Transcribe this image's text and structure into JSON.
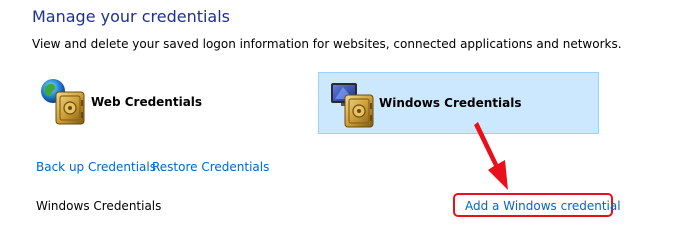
{
  "header": {
    "title": "Manage your credentials",
    "description": "View and delete your saved logon information for websites, connected applications and networks."
  },
  "tiles": {
    "web": {
      "label": "Web Credentials",
      "icon": "web-credentials-vault-icon"
    },
    "windows": {
      "label": "Windows Credentials",
      "icon": "windows-credentials-vault-icon",
      "selected": true
    }
  },
  "actions": {
    "backup": "Back up Credentials",
    "restore": "Restore Credentials"
  },
  "section": {
    "label": "Windows Credentials",
    "add_link": "Add a Windows credential"
  },
  "colors": {
    "title": "#1e3287",
    "link": "#0066cc",
    "selected_tile_bg": "#cce8ff",
    "selected_tile_border": "#99d1ff",
    "annotation": "#e8101a"
  }
}
